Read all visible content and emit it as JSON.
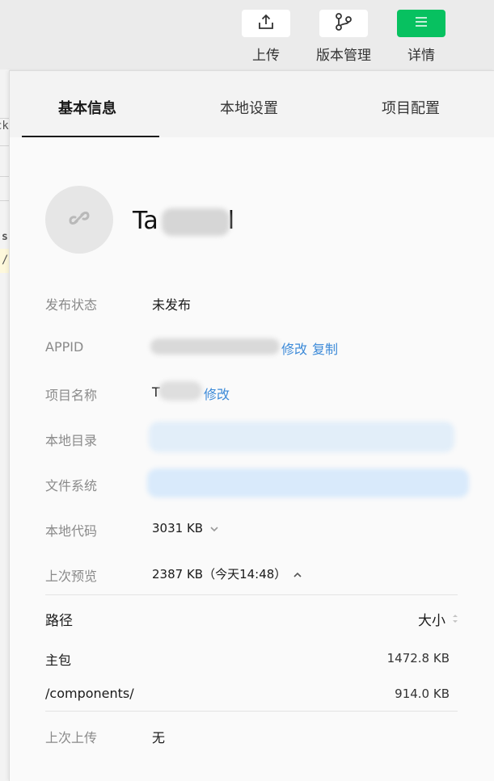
{
  "toolbar": {
    "upload_label": "上传",
    "version_label": "版本管理",
    "detail_label": "详情"
  },
  "background_editor": {
    "fragments": [
      "ck",
      "s",
      "/"
    ]
  },
  "tabs": [
    {
      "label": "基本信息",
      "active": true
    },
    {
      "label": "本地设置",
      "active": false
    },
    {
      "label": "项目配置",
      "active": false
    }
  ],
  "project": {
    "title_start": "Ta",
    "title_end": "l"
  },
  "info": {
    "publish_status": {
      "label": "发布状态",
      "value": "未发布"
    },
    "appid": {
      "label": "APPID",
      "edit_link": "修改",
      "copy_link": "复制"
    },
    "project_name": {
      "label": "项目名称",
      "value_start": "T",
      "edit_link": "修改"
    },
    "local_dir": {
      "label": "本地目录"
    },
    "file_system": {
      "label": "文件系统"
    },
    "local_code": {
      "label": "本地代码",
      "value": "3031 KB"
    },
    "last_preview": {
      "label": "上次预览",
      "value": "2387 KB（今天14:48）"
    },
    "last_upload": {
      "label": "上次上传",
      "value": "无"
    }
  },
  "package_table": {
    "headers": {
      "path": "路径",
      "size": "大小"
    },
    "rows": [
      {
        "path": "主包",
        "size": "1472.8 KB"
      },
      {
        "path": "/components/",
        "size": "914.0 KB"
      }
    ]
  },
  "colors": {
    "accent_green": "#07c160",
    "link_blue": "#3c8ad8",
    "label_gray": "#8a8a8a"
  },
  "icons": {
    "upload": "upload-icon",
    "version": "branch-icon",
    "detail": "menu-icon",
    "avatar": "link-icon"
  }
}
